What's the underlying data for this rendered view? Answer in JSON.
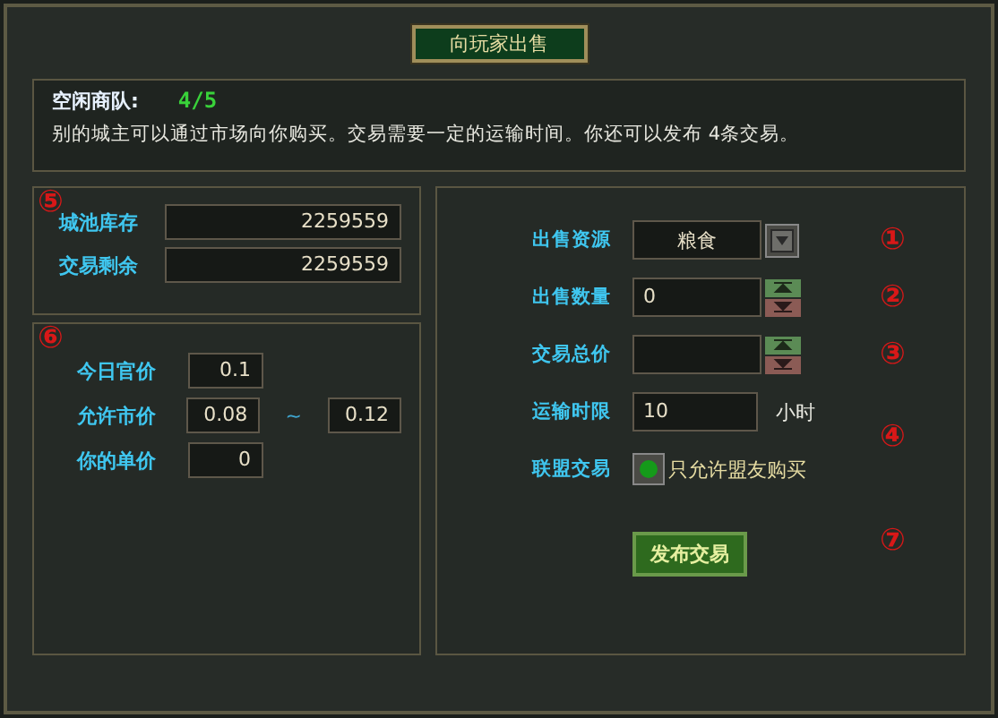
{
  "title": "向玩家出售",
  "info": {
    "label": "空闲商队:",
    "value": "4/5",
    "text": "别的城主可以通过市场向你购买。交易需要一定的运输时间。你还可以发布 4条交易。"
  },
  "stock_panel": {
    "marker": "⑤",
    "rows": [
      {
        "label": "城池库存",
        "value": "2259559"
      },
      {
        "label": "交易剩余",
        "value": "2259559"
      }
    ]
  },
  "price_panel": {
    "marker": "⑥",
    "rows": [
      {
        "label": "今日官价",
        "values": [
          "0.1"
        ]
      },
      {
        "label": "允许市价",
        "values": [
          "0.08",
          "0.12"
        ],
        "separator": "~"
      },
      {
        "label": "你的单价",
        "values": [
          "0"
        ]
      }
    ]
  },
  "form": {
    "rows": [
      {
        "kind": "select",
        "label": "出售资源",
        "value": "粮食",
        "marker": "①"
      },
      {
        "kind": "spinner",
        "label": "出售数量",
        "value": "0",
        "marker": "②"
      },
      {
        "kind": "spinner",
        "label": "交易总价",
        "marker": "③"
      },
      {
        "kind": "text",
        "label": "运输时限",
        "value": "10",
        "unit": "小时",
        "marker": "④"
      },
      {
        "kind": "checkbox",
        "label": "联盟交易",
        "checked": true,
        "text": "只允许盟友购买"
      }
    ],
    "submit": {
      "label": "发布交易",
      "marker": "⑦"
    }
  }
}
